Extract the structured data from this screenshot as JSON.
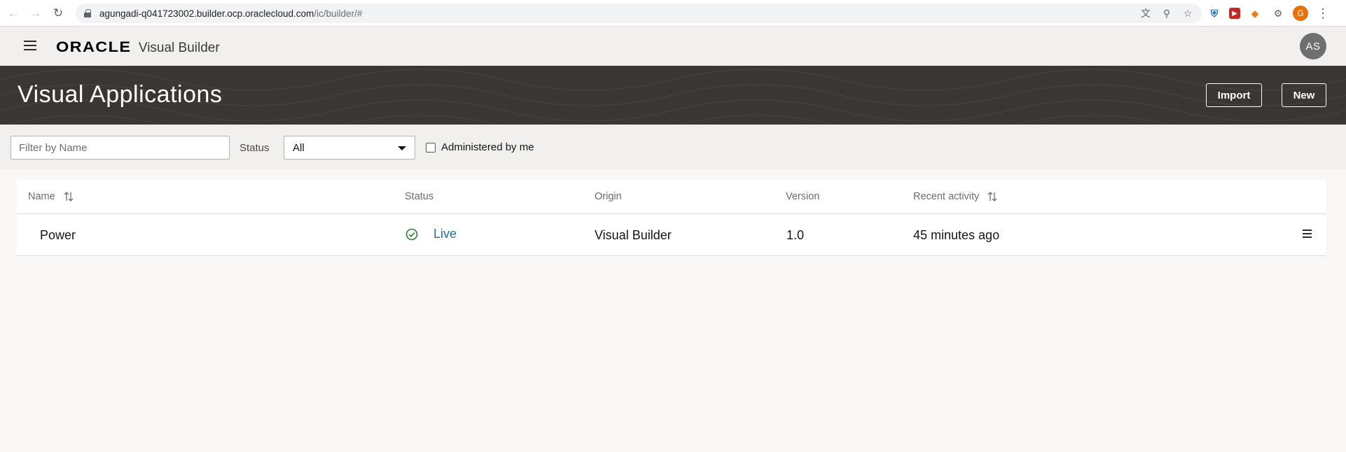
{
  "browser": {
    "url_host": "agungadi-q041723002.builder.ocp.oraclecloud.com",
    "url_path": "/ic/builder/#",
    "profile_initial": "G"
  },
  "header": {
    "brand": "ORACLE",
    "product": "Visual Builder",
    "avatar_initials": "AS"
  },
  "banner": {
    "title": "Visual Applications",
    "import_label": "Import",
    "new_label": "New"
  },
  "filters": {
    "name_placeholder": "Filter by Name",
    "name_value": "",
    "status_label": "Status",
    "status_selected": "All",
    "admin_label": "Administered by me",
    "admin_checked": false
  },
  "table": {
    "columns": {
      "name": "Name",
      "status": "Status",
      "origin": "Origin",
      "version": "Version",
      "recent": "Recent activity"
    },
    "rows": [
      {
        "name": "Power",
        "status": "Live",
        "origin": "Visual Builder",
        "version": "1.0",
        "recent": "45 minutes ago"
      }
    ]
  },
  "colors": {
    "banner_bg": "#3a3633",
    "header_bg": "#f1f0ee",
    "link": "#1f6f95",
    "status_ok": "#2e7d32"
  }
}
